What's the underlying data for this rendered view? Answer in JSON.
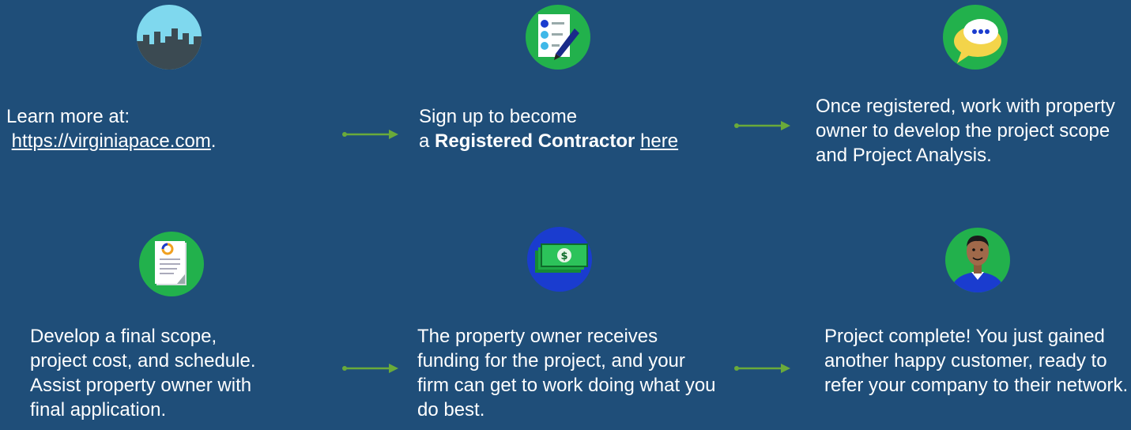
{
  "steps": [
    {
      "icon": "city-skyline-icon",
      "line1": "Learn more at:",
      "link": "https://virginiapace.com",
      "after_link": "."
    },
    {
      "icon": "registration-form-icon",
      "line1": "Sign up to become",
      "prefix": "a ",
      "bold": "Registered Contractor",
      "link": "here"
    },
    {
      "icon": "chat-bubbles-icon",
      "text": "Once registered, work with property owner to develop the project scope and Project Analysis."
    },
    {
      "icon": "document-report-icon",
      "text": "Develop a final scope, project cost, and schedule. Assist property owner with final application."
    },
    {
      "icon": "money-bills-icon",
      "text": "The property owner receives funding for the project, and your firm can get to work doing what you do best."
    },
    {
      "icon": "happy-customer-icon",
      "text": "Project complete! You just gained another happy customer, ready to refer your company to their network."
    }
  ],
  "colors": {
    "background": "#1f4e79",
    "arrow": "#6aaa3a",
    "icon_green": "#22b14c",
    "icon_blue": "#1a3ccf"
  }
}
